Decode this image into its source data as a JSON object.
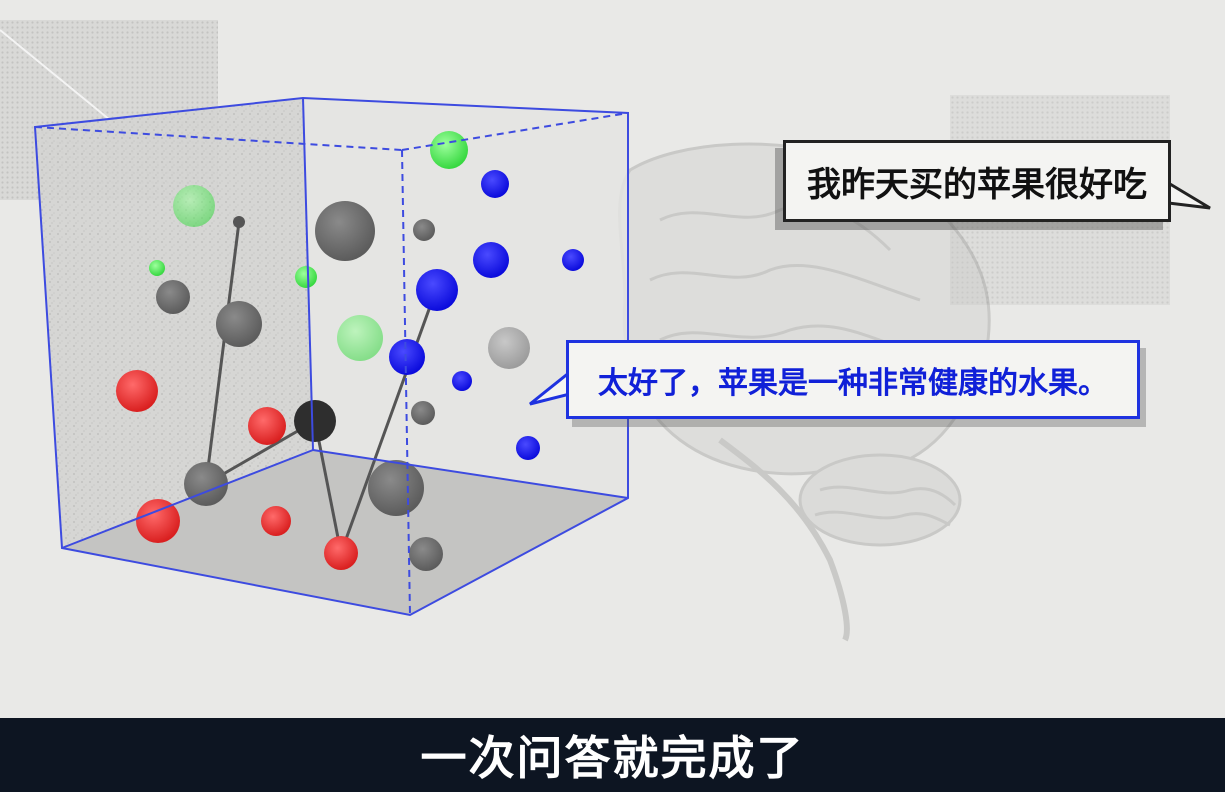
{
  "colors": {
    "background": "#e9e9e7",
    "cube_edge": "#3d4be0",
    "sphere_red": "#e12626",
    "sphere_green": "#3fe34a",
    "sphere_blue": "#1212e6",
    "sphere_gray": "#6a6a6a",
    "user_text": "#111111",
    "ai_text": "#1020d8",
    "caption_bar": "#0d1522",
    "caption_text": "#ffffff"
  },
  "user_bubble": {
    "text": "我昨天买的苹果很好吃"
  },
  "ai_bubble": {
    "text": "太好了，苹果是一种非常健康的水果。"
  },
  "caption": {
    "text": "一次问答就完成了"
  },
  "icons": [
    "brain-illustration",
    "word-embedding-cube",
    "speech-bubble-tail"
  ]
}
